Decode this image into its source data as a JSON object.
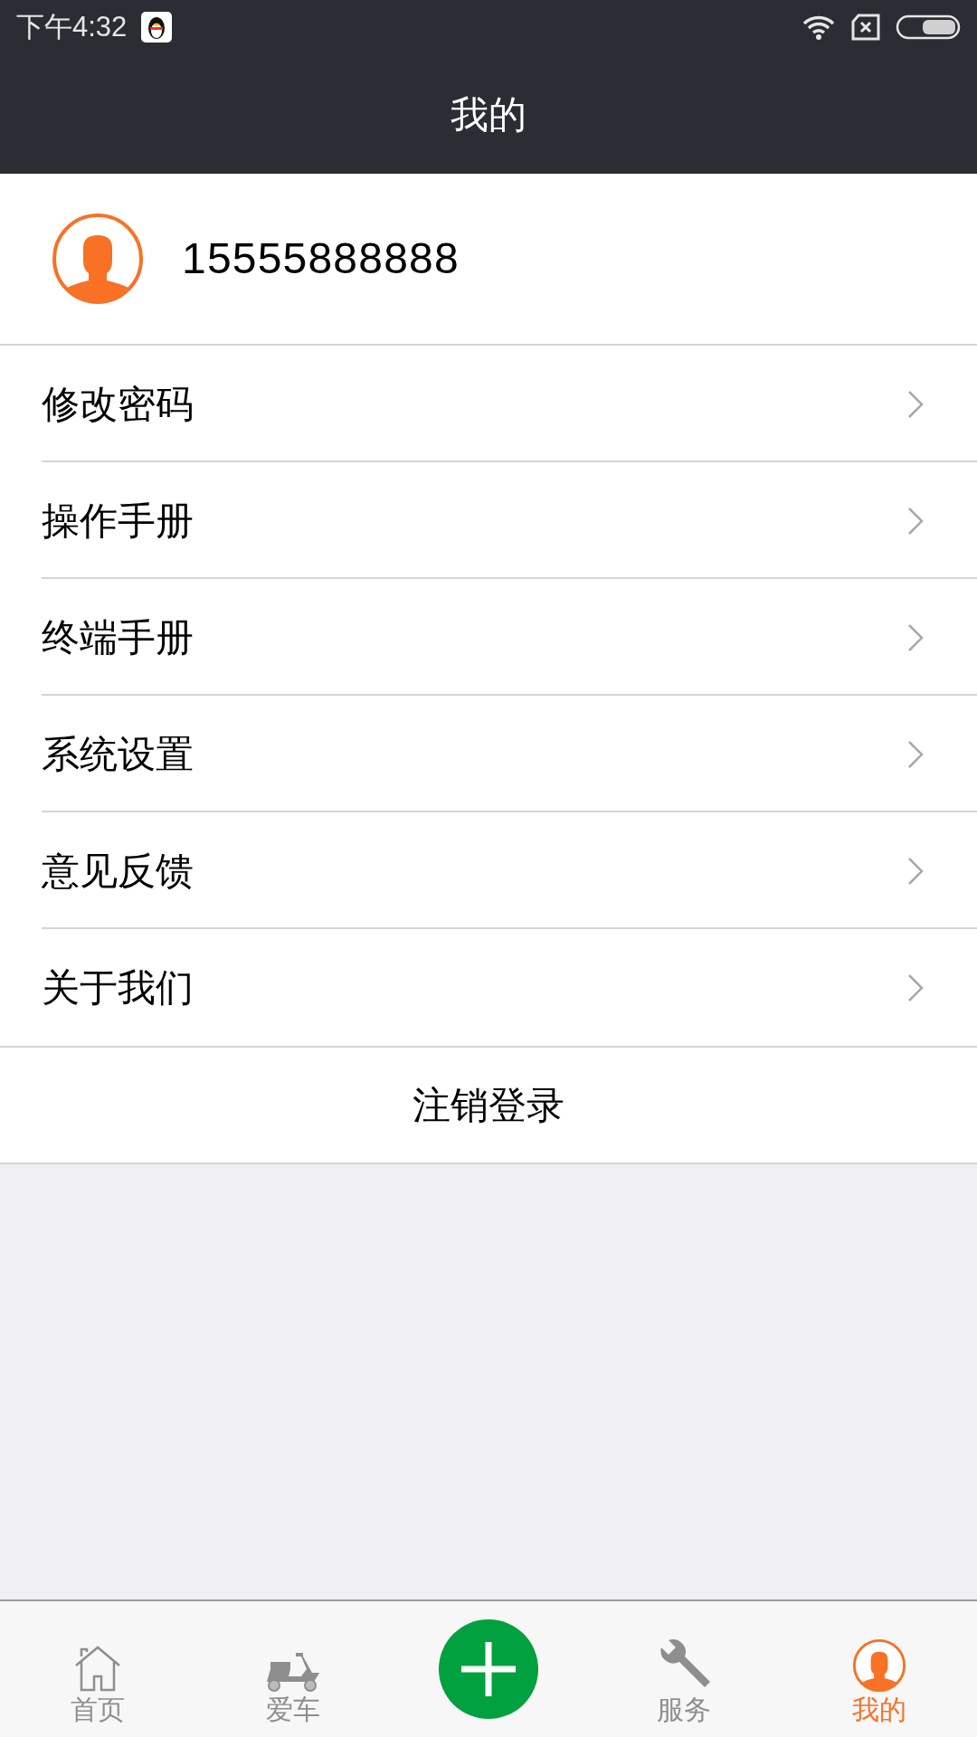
{
  "status_bar": {
    "time": "下午4:32"
  },
  "header": {
    "title": "我的"
  },
  "profile": {
    "phone": "15555888888"
  },
  "menu": [
    {
      "label": "修改密码"
    },
    {
      "label": "操作手册"
    },
    {
      "label": "终端手册"
    },
    {
      "label": "系统设置"
    },
    {
      "label": "意见反馈"
    },
    {
      "label": "关于我们"
    }
  ],
  "logout": {
    "label": "注销登录"
  },
  "tab_bar": [
    {
      "kind": "home",
      "label": "首页",
      "selected": false
    },
    {
      "kind": "scooter",
      "label": "爱车",
      "selected": false
    },
    {
      "kind": "add"
    },
    {
      "kind": "wrench",
      "label": "服务",
      "selected": false
    },
    {
      "kind": "person",
      "label": "我的",
      "selected": true
    }
  ]
}
